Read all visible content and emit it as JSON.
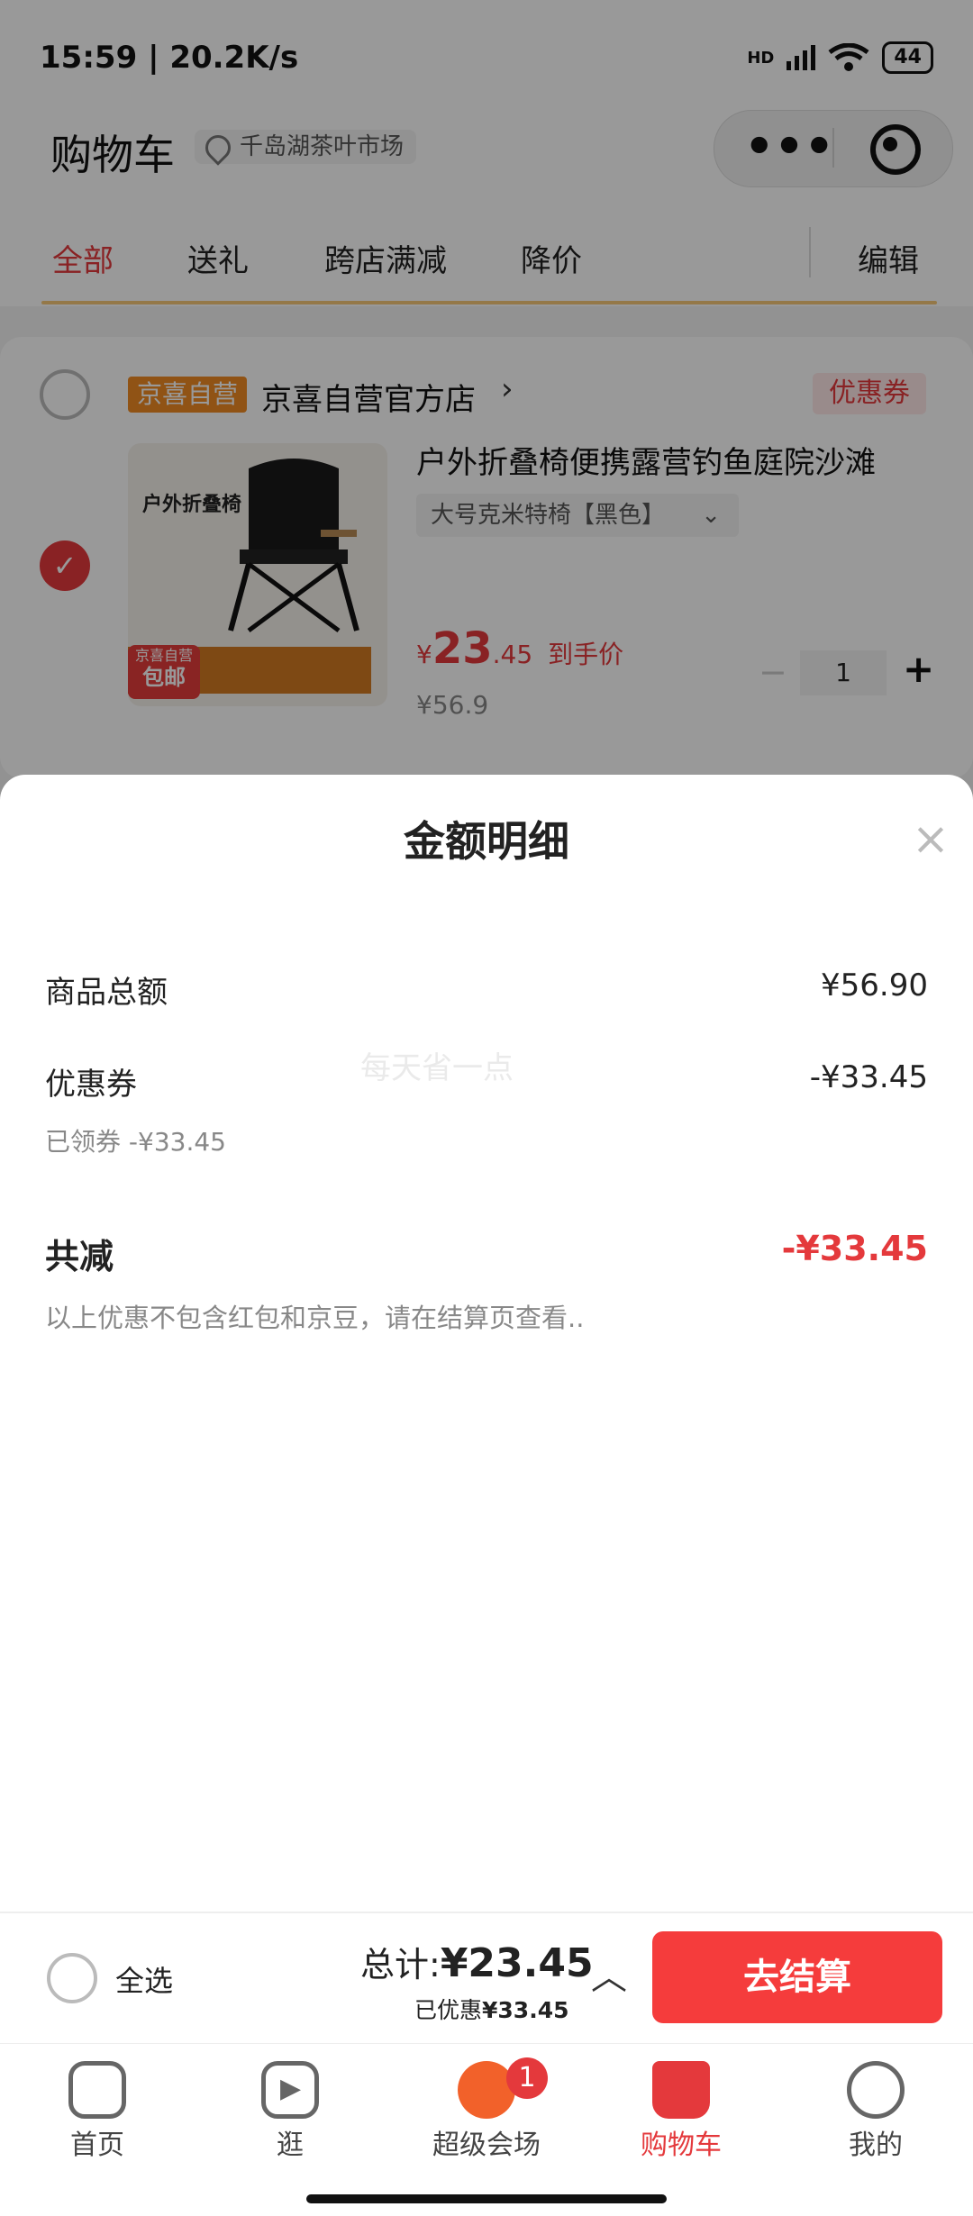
{
  "status_bar": {
    "time": "15:59 | 20.2K/s",
    "signal": "HD",
    "battery": "44"
  },
  "header": {
    "title": "购物车",
    "location": "千岛湖茶叶市场",
    "more_label": "•••"
  },
  "tabs": [
    {
      "label": "全部",
      "active": true
    },
    {
      "label": "送礼"
    },
    {
      "label": "跨店满减"
    },
    {
      "label": "降价"
    }
  ],
  "edit_label": "编辑",
  "store": {
    "badge": "京喜自营",
    "name": "京喜自营官方店",
    "arrow": "›",
    "coupon_label": "优惠券",
    "product": {
      "image_title": "户外折叠椅",
      "image_badge_top": "京喜自营",
      "image_badge_bottom": "包邮",
      "name": "户外折叠椅便携露营钓鱼庭院沙滩",
      "spec": "大号克米特椅【黑色】",
      "price_symbol": "¥",
      "price_int": "23",
      "price_dec": ".45",
      "price_suffix": "到手价",
      "orig_price": "¥56.9",
      "qty": "1",
      "minus": "−",
      "plus": "+"
    }
  },
  "sheet": {
    "title": "金额明细",
    "close": "×",
    "rows": [
      {
        "label": "商品总额",
        "value": "¥56.90"
      },
      {
        "label": "优惠券",
        "value": "-¥33.45",
        "sub": "已领券 -¥33.45"
      }
    ],
    "watermark": "每天省一点",
    "total_reduce": {
      "label": "共减",
      "value": "-¥33.45"
    },
    "note": "以上优惠不包含红包和京豆，请在结算页查看.."
  },
  "action_bar": {
    "select_all": "全选",
    "total_label": "总计:",
    "total_value": "¥23.45",
    "saved_label": "已优惠",
    "saved_value": "¥33.45",
    "checkout": "去结算"
  },
  "nav": [
    {
      "label": "首页",
      "icon": "home-icon"
    },
    {
      "label": "逛",
      "icon": "play-icon"
    },
    {
      "label": "超级会场",
      "icon": "venue-icon",
      "badge": "1"
    },
    {
      "label": "购物车",
      "icon": "cart-icon",
      "active": true
    },
    {
      "label": "我的",
      "icon": "profile-icon"
    }
  ],
  "colors": {
    "accent": "#e4393c",
    "checkout": "#f53c3c",
    "self_badge": "#f08a24"
  }
}
